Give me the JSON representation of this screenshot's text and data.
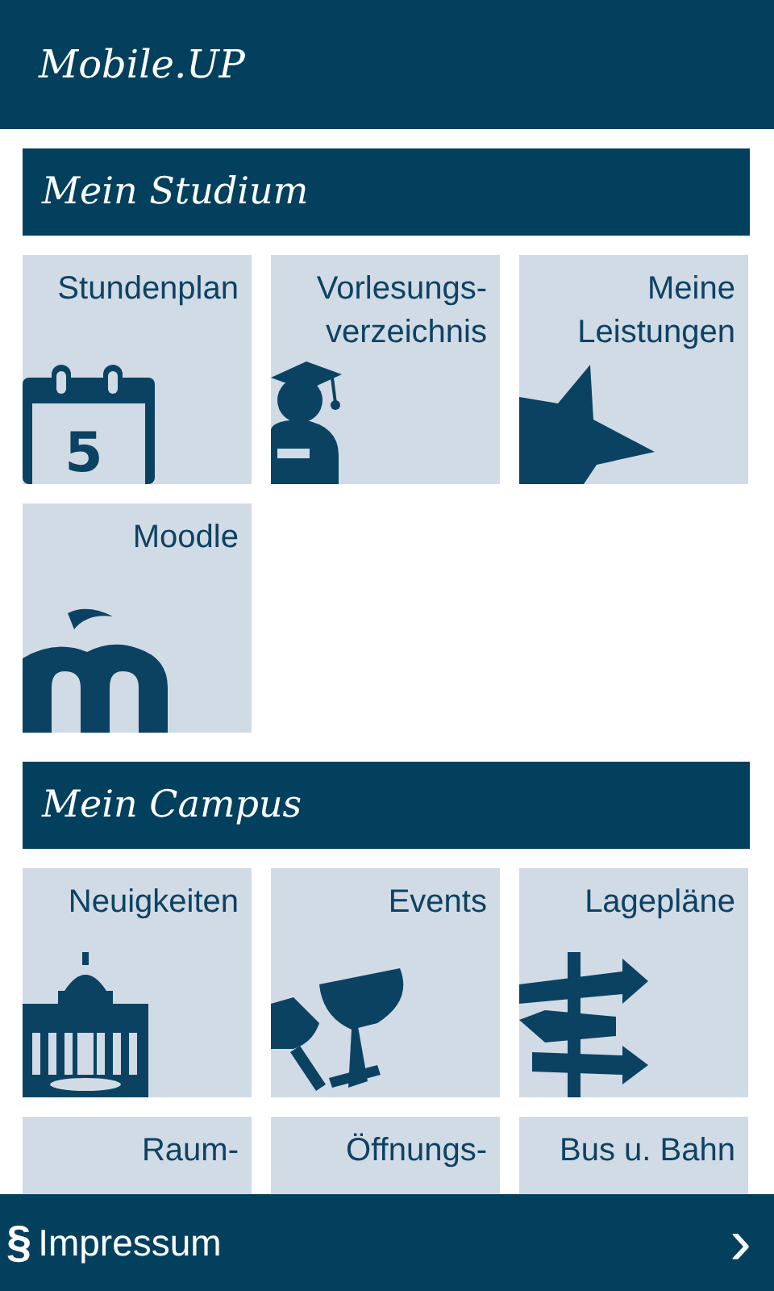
{
  "app_bar": {
    "title": "Mobile.UP"
  },
  "sections": [
    {
      "title": "Mein Studium",
      "tiles": [
        {
          "label": "Stundenplan",
          "kind": "calendar",
          "day": "5"
        },
        {
          "label": "Vorlesungs-\nverzeichnis",
          "kind": "graduate"
        },
        {
          "label": "Meine\nLeistungen",
          "kind": "star"
        },
        {
          "label": "Moodle",
          "kind": "moodle"
        }
      ]
    },
    {
      "title": "Mein Campus",
      "tiles": [
        {
          "label": "Neuigkeiten",
          "kind": "building"
        },
        {
          "label": "Events",
          "kind": "glasses"
        },
        {
          "label": "Lagepläne",
          "kind": "signpost"
        },
        {
          "label": "Raum-",
          "kind": "none"
        },
        {
          "label": "Öffnungs-",
          "kind": "none"
        },
        {
          "label": "Bus u. Bahn",
          "kind": "none"
        }
      ]
    }
  ],
  "footer": {
    "icon_glyph": "§",
    "label": "Impressum",
    "chevron": "›"
  }
}
